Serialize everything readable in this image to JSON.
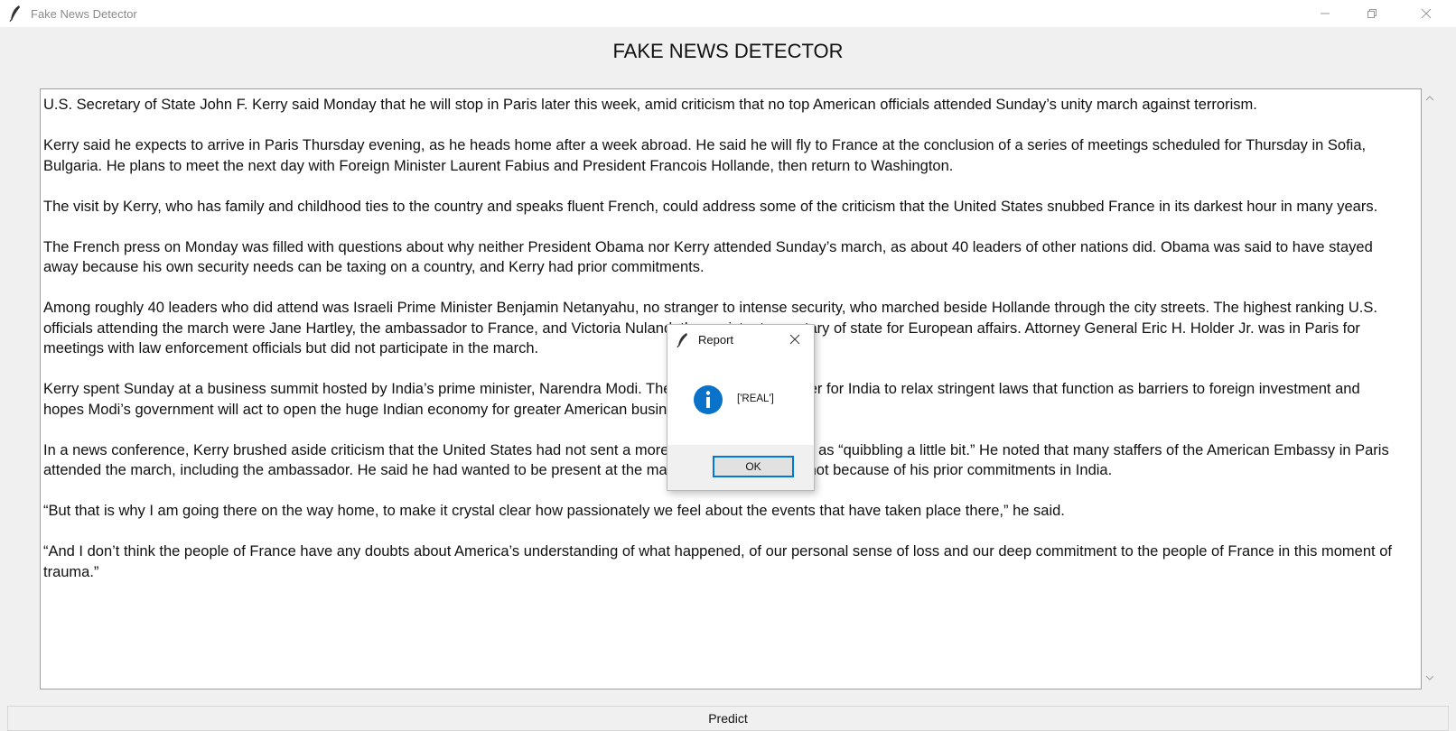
{
  "window": {
    "title": "Fake News Detector"
  },
  "app": {
    "heading": "FAKE NEWS DETECTOR",
    "predict_label": "Predict"
  },
  "article": {
    "paragraphs": [
      "U.S. Secretary of State John F. Kerry said Monday that he will stop in Paris later this week, amid criticism that no top American officials attended Sunday’s unity march against terrorism.",
      "Kerry said he expects to arrive in Paris Thursday evening, as he heads home after a week abroad. He said he will fly to France at the conclusion of a series of meetings scheduled for Thursday in Sofia, Bulgaria. He plans to meet the next day with Foreign Minister Laurent Fabius and President Francois Hollande, then return to Washington.",
      "The visit by Kerry, who has family and childhood ties to the country and speaks fluent French, could address some of the criticism that the United States snubbed France in its darkest hour in many years.",
      "The French press on Monday was filled with questions about why neither President Obama nor Kerry attended Sunday’s march, as about 40 leaders of other nations did. Obama was said to have stayed away because his own security needs can be taxing on a country, and Kerry had prior commitments.",
      "Among roughly 40 leaders who did attend was Israeli Prime Minister Benjamin Netanyahu, no stranger to intense security, who marched beside Hollande through the city streets. The highest ranking U.S. officials attending the march were Jane Hartley, the ambassador to France, and Victoria Nuland, the assistant secretary of state for European affairs. Attorney General Eric H. Holder Jr. was in Paris for meetings with law enforcement officials but did not participate in the march.",
      "Kerry spent Sunday at a business summit hosted by India’s prime minister, Narendra Modi. The United States is eager for India to relax stringent laws that function as barriers to foreign investment and hopes Modi’s government will act to open the huge Indian economy for greater American businesses.",
      "In a news conference, Kerry brushed aside criticism that the United States had not sent a more senior official to Paris as “quibbling a little bit.” He noted that many staffers of the American Embassy in Paris attended the march, including the ambassador. He said he had wanted to be present at the march himself but could not because of his prior commitments in India.",
      "“But that is why I am going there on the way home, to make it crystal clear how passionately we feel about the events that have taken place there,” he said.",
      "“And I don’t think the people of France have any doubts about America’s understanding of what happened, of our personal sense of loss and our deep commitment to the people of France in this moment of trauma.”"
    ]
  },
  "dialog": {
    "title": "Report",
    "message": "['REAL']",
    "ok_label": "OK",
    "icon": "info-icon"
  },
  "colors": {
    "info_blue": "#0a72c8",
    "ok_border": "#0078d7"
  }
}
